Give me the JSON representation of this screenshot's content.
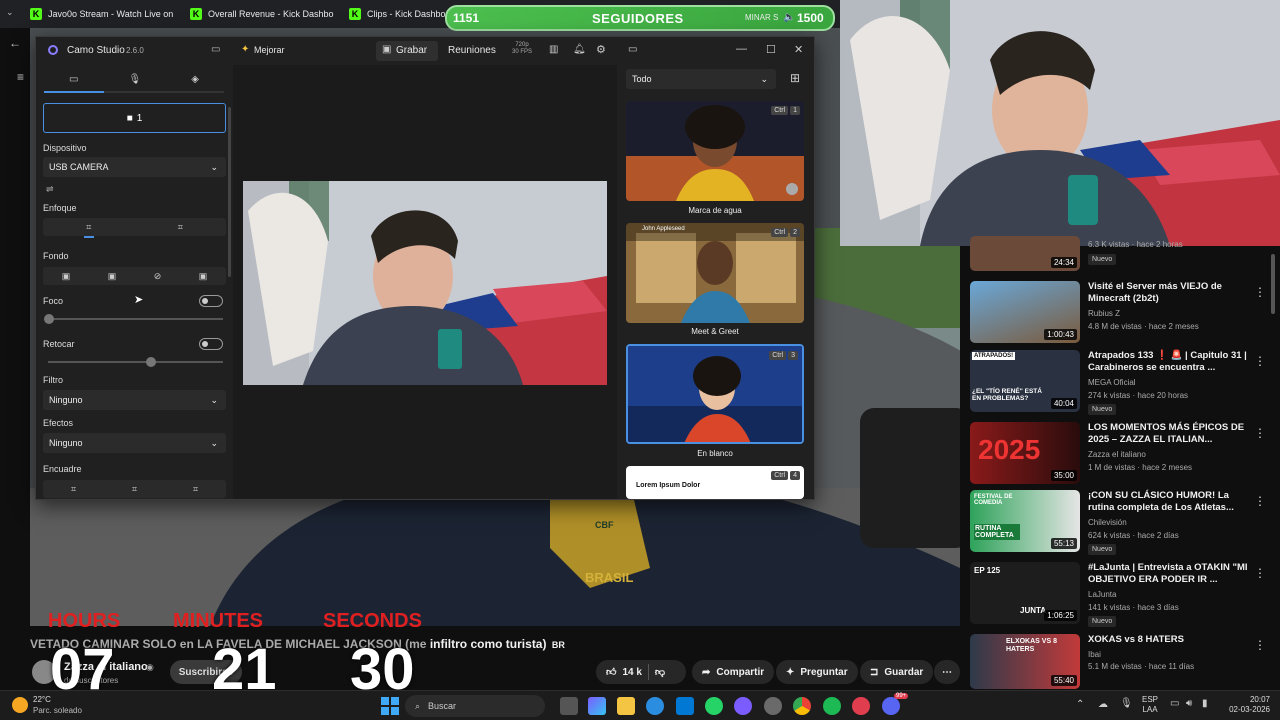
{
  "browser": {
    "tabs": [
      {
        "label": "Javo0o Stream - Watch Live on"
      },
      {
        "label": "Overall Revenue - Kick Dashbo"
      },
      {
        "label": "Clips - Kick Dashboard"
      }
    ]
  },
  "overlay": {
    "followers_current": "1151",
    "followers_label": "SEGUIDORES",
    "followers_goal": "1500",
    "ticker_fragment": "MINAR S"
  },
  "camo": {
    "app_name": "Camo Studio",
    "version": "2.6.0",
    "enhance_label": "Mejorar",
    "record_label": "Grabar",
    "meetings_label": "Reuniones",
    "resolution": "720p",
    "fps": "30 FPS",
    "camera_slot": "1",
    "device_label": "Dispositivo",
    "device_value": "USB CAMERA",
    "focus_label": "Enfoque",
    "background_label": "Fondo",
    "foco_label": "Foco",
    "retouch_label": "Retocar",
    "filter_label": "Filtro",
    "filter_value": "Ninguno",
    "effects_label": "Efectos",
    "effects_value": "Ninguno",
    "framing_label": "Encuadre",
    "overlay_filter": "Todo",
    "overlays": [
      {
        "label": "Marca de agua",
        "ctrl": "Ctrl",
        "num": "1"
      },
      {
        "label": "Meet & Greet",
        "ctrl": "Ctrl",
        "num": "2",
        "name_tag": "John Appleseed"
      },
      {
        "label": "En blanco",
        "ctrl": "Ctrl",
        "num": "3"
      },
      {
        "label": "",
        "ctrl": "Ctrl",
        "num": "4",
        "text": "Lorem Ipsum Dolor"
      }
    ]
  },
  "video": {
    "title_prefix": "VETADO CAMINAR SOLO en LA FAVELA DE MICHAEL JACKSON (me ",
    "title_bold": "infiltro como turista)",
    "title_suffix": "BR",
    "channel": "Zazza el italiano",
    "subscribers": "de suscriptores",
    "subscribe_label": "Suscribirse",
    "likes": "14 k",
    "share_label": "Compartir",
    "ask_label": "Preguntar",
    "save_label": "Guardar",
    "jersey_text": "BRASIL",
    "jersey_crest": "CBF"
  },
  "timer": {
    "hours_label": "HOURS",
    "minutes_label": "MINUTES",
    "seconds_label": "SECONDS",
    "hours": "07",
    "minutes": "21",
    "seconds": "30"
  },
  "sidebar": {
    "items": [
      {
        "title": "",
        "channel": "",
        "meta": "6.3 K vistas · hace 2 horas",
        "duration": "24:34",
        "badge": "Nuevo"
      },
      {
        "title": "Visité el Server más VIEJO de Minecraft (2b2t)",
        "channel": "Rubius Z",
        "meta": "4.8 M de vistas · hace 2 meses",
        "duration": "1:00:43",
        "badge": ""
      },
      {
        "title": "Atrapados 133 ❗ 🚨 | Capitulo 31 | Carabineros se encuentra ...",
        "channel": "MEGA Oficial",
        "meta": "274 k vistas · hace 20 horas",
        "duration": "40:04",
        "badge": "Nuevo",
        "thumb_text": "¿EL \"TÍO RENÉ\" ESTÁ EN PROBLEMAS?",
        "thumb_tag": "ATRAPADOS!"
      },
      {
        "title": "LOS MOMENTOS MÁS ÉPICOS DE 2025 – ZAZZA EL ITALIAN...",
        "channel": "Zazza el italiano",
        "meta": "1 M de vistas · hace 2 meses",
        "duration": "35:00",
        "badge": "",
        "thumb_text": "2025"
      },
      {
        "title": "¡CON SU CLÁSICO HUMOR! La rutina completa de Los Atletas...",
        "channel": "Chilevisión",
        "meta": "624 k vistas · hace 2 días",
        "duration": "55:13",
        "badge": "Nuevo",
        "thumb_text": "RUTINA COMPLETA",
        "thumb_tag": "FESTIVAL DE COMEDIA"
      },
      {
        "title": "#LaJunta | Entrevista a OTAKIN \"MI OBJETIVO ERA PODER IR ...",
        "channel": "LaJunta",
        "meta": "141 k vistas · hace 3 días",
        "duration": "1:06:25",
        "badge": "Nuevo",
        "thumb_text": "EP 125",
        "thumb_tag": "JUNTA"
      },
      {
        "title": "XOKAS vs 8 HATERS",
        "channel": "Ibai",
        "meta": "5.1 M de vistas · hace 11 días",
        "duration": "55:40",
        "badge": "",
        "thumb_text": "ELXOKAS VS 8 HATERS"
      }
    ]
  },
  "taskbar": {
    "temp": "22°C",
    "weather": "Parc. soleado",
    "search_placeholder": "Buscar",
    "lang": "ESP",
    "lang2": "LAA",
    "time": "20:07",
    "date": "02-03-2026",
    "badge": "99+"
  },
  "colors": {
    "kick_green": "#53fc18",
    "camo_accent": "#4a90e2",
    "timer_red": "#e02020"
  }
}
